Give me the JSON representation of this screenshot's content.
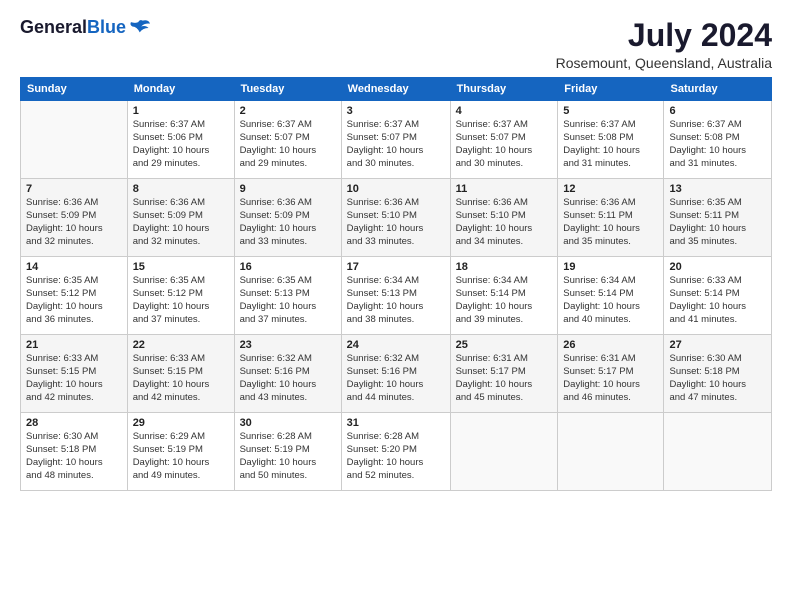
{
  "header": {
    "logo_general": "General",
    "logo_blue": "Blue",
    "month": "July 2024",
    "location": "Rosemount, Queensland, Australia"
  },
  "weekdays": [
    "Sunday",
    "Monday",
    "Tuesday",
    "Wednesday",
    "Thursday",
    "Friday",
    "Saturday"
  ],
  "weeks": [
    [
      {
        "day": "",
        "info": ""
      },
      {
        "day": "1",
        "info": "Sunrise: 6:37 AM\nSunset: 5:06 PM\nDaylight: 10 hours\nand 29 minutes."
      },
      {
        "day": "2",
        "info": "Sunrise: 6:37 AM\nSunset: 5:07 PM\nDaylight: 10 hours\nand 29 minutes."
      },
      {
        "day": "3",
        "info": "Sunrise: 6:37 AM\nSunset: 5:07 PM\nDaylight: 10 hours\nand 30 minutes."
      },
      {
        "day": "4",
        "info": "Sunrise: 6:37 AM\nSunset: 5:07 PM\nDaylight: 10 hours\nand 30 minutes."
      },
      {
        "day": "5",
        "info": "Sunrise: 6:37 AM\nSunset: 5:08 PM\nDaylight: 10 hours\nand 31 minutes."
      },
      {
        "day": "6",
        "info": "Sunrise: 6:37 AM\nSunset: 5:08 PM\nDaylight: 10 hours\nand 31 minutes."
      }
    ],
    [
      {
        "day": "7",
        "info": "Sunrise: 6:36 AM\nSunset: 5:09 PM\nDaylight: 10 hours\nand 32 minutes."
      },
      {
        "day": "8",
        "info": "Sunrise: 6:36 AM\nSunset: 5:09 PM\nDaylight: 10 hours\nand 32 minutes."
      },
      {
        "day": "9",
        "info": "Sunrise: 6:36 AM\nSunset: 5:09 PM\nDaylight: 10 hours\nand 33 minutes."
      },
      {
        "day": "10",
        "info": "Sunrise: 6:36 AM\nSunset: 5:10 PM\nDaylight: 10 hours\nand 33 minutes."
      },
      {
        "day": "11",
        "info": "Sunrise: 6:36 AM\nSunset: 5:10 PM\nDaylight: 10 hours\nand 34 minutes."
      },
      {
        "day": "12",
        "info": "Sunrise: 6:36 AM\nSunset: 5:11 PM\nDaylight: 10 hours\nand 35 minutes."
      },
      {
        "day": "13",
        "info": "Sunrise: 6:35 AM\nSunset: 5:11 PM\nDaylight: 10 hours\nand 35 minutes."
      }
    ],
    [
      {
        "day": "14",
        "info": "Sunrise: 6:35 AM\nSunset: 5:12 PM\nDaylight: 10 hours\nand 36 minutes."
      },
      {
        "day": "15",
        "info": "Sunrise: 6:35 AM\nSunset: 5:12 PM\nDaylight: 10 hours\nand 37 minutes."
      },
      {
        "day": "16",
        "info": "Sunrise: 6:35 AM\nSunset: 5:13 PM\nDaylight: 10 hours\nand 37 minutes."
      },
      {
        "day": "17",
        "info": "Sunrise: 6:34 AM\nSunset: 5:13 PM\nDaylight: 10 hours\nand 38 minutes."
      },
      {
        "day": "18",
        "info": "Sunrise: 6:34 AM\nSunset: 5:14 PM\nDaylight: 10 hours\nand 39 minutes."
      },
      {
        "day": "19",
        "info": "Sunrise: 6:34 AM\nSunset: 5:14 PM\nDaylight: 10 hours\nand 40 minutes."
      },
      {
        "day": "20",
        "info": "Sunrise: 6:33 AM\nSunset: 5:14 PM\nDaylight: 10 hours\nand 41 minutes."
      }
    ],
    [
      {
        "day": "21",
        "info": "Sunrise: 6:33 AM\nSunset: 5:15 PM\nDaylight: 10 hours\nand 42 minutes."
      },
      {
        "day": "22",
        "info": "Sunrise: 6:33 AM\nSunset: 5:15 PM\nDaylight: 10 hours\nand 42 minutes."
      },
      {
        "day": "23",
        "info": "Sunrise: 6:32 AM\nSunset: 5:16 PM\nDaylight: 10 hours\nand 43 minutes."
      },
      {
        "day": "24",
        "info": "Sunrise: 6:32 AM\nSunset: 5:16 PM\nDaylight: 10 hours\nand 44 minutes."
      },
      {
        "day": "25",
        "info": "Sunrise: 6:31 AM\nSunset: 5:17 PM\nDaylight: 10 hours\nand 45 minutes."
      },
      {
        "day": "26",
        "info": "Sunrise: 6:31 AM\nSunset: 5:17 PM\nDaylight: 10 hours\nand 46 minutes."
      },
      {
        "day": "27",
        "info": "Sunrise: 6:30 AM\nSunset: 5:18 PM\nDaylight: 10 hours\nand 47 minutes."
      }
    ],
    [
      {
        "day": "28",
        "info": "Sunrise: 6:30 AM\nSunset: 5:18 PM\nDaylight: 10 hours\nand 48 minutes."
      },
      {
        "day": "29",
        "info": "Sunrise: 6:29 AM\nSunset: 5:19 PM\nDaylight: 10 hours\nand 49 minutes."
      },
      {
        "day": "30",
        "info": "Sunrise: 6:28 AM\nSunset: 5:19 PM\nDaylight: 10 hours\nand 50 minutes."
      },
      {
        "day": "31",
        "info": "Sunrise: 6:28 AM\nSunset: 5:20 PM\nDaylight: 10 hours\nand 52 minutes."
      },
      {
        "day": "",
        "info": ""
      },
      {
        "day": "",
        "info": ""
      },
      {
        "day": "",
        "info": ""
      }
    ]
  ]
}
